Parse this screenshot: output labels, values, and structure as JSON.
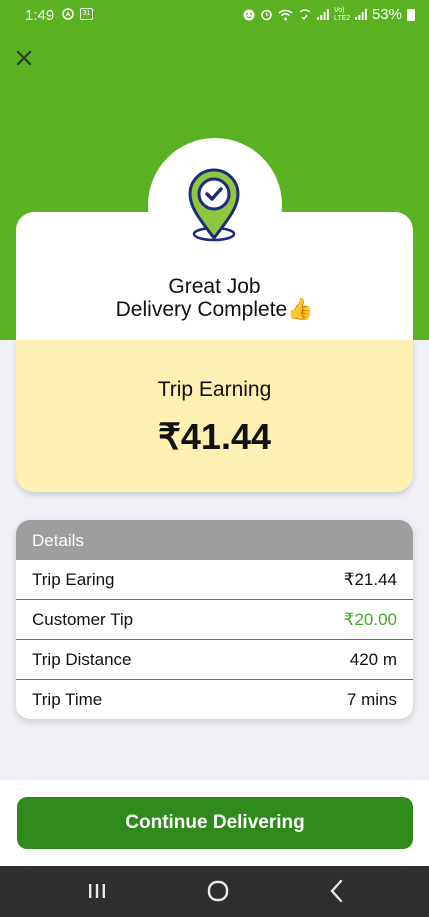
{
  "status_bar": {
    "time": "1:49",
    "calendar_day": "31",
    "volte_label": "Vo) LTE2",
    "battery": "53%"
  },
  "header": {
    "close_icon": "close-icon"
  },
  "completion": {
    "line1": "Great Job",
    "line2": "Delivery Complete👍"
  },
  "earning": {
    "label": "Trip Earning",
    "amount": "₹41.44"
  },
  "details": {
    "title": "Details",
    "rows": [
      {
        "label": "Trip Earing",
        "value": "₹21.44"
      },
      {
        "label": "Customer Tip",
        "value": "₹20.00"
      },
      {
        "label": "Trip Distance",
        "value": "420 m"
      },
      {
        "label": "Trip Time",
        "value": "7 mins"
      }
    ]
  },
  "actions": {
    "continue_label": "Continue Delivering"
  },
  "colors": {
    "brand_green": "#5ab223",
    "button_green": "#2f8a1b",
    "tip_green": "#4aa82b",
    "earning_bg": "#fdf0b3"
  }
}
